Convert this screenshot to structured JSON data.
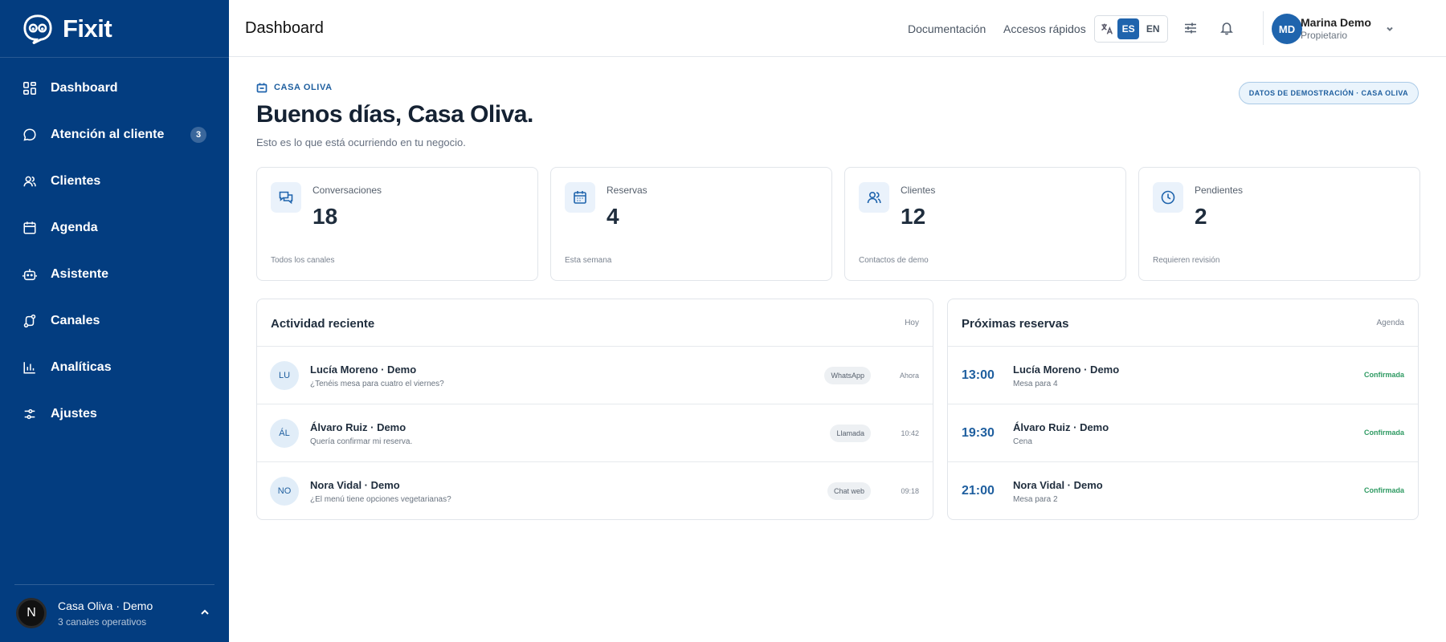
{
  "app": {
    "name": "Fixit"
  },
  "sidebar": {
    "items": [
      {
        "label": "Dashboard",
        "icon": "grid-icon"
      },
      {
        "label": "Atención al cliente",
        "icon": "chat-bubble-icon",
        "badge": "3"
      },
      {
        "label": "Clientes",
        "icon": "users-icon"
      },
      {
        "label": "Agenda",
        "icon": "calendar-icon"
      },
      {
        "label": "Asistente",
        "icon": "bot-icon"
      },
      {
        "label": "Canales",
        "icon": "route-icon"
      },
      {
        "label": "Analíticas",
        "icon": "bar-chart-icon"
      },
      {
        "label": "Ajustes",
        "icon": "sliders-icon"
      }
    ],
    "workspace": {
      "avatar": "N",
      "name": "Casa Oliva · Demo",
      "sub": "3 canales operativos"
    }
  },
  "header": {
    "title": "Dashboard",
    "links": [
      "Documentación",
      "Accesos rápidos"
    ],
    "lang": {
      "active": "ES",
      "other": "EN"
    },
    "user": {
      "initials": "MD",
      "name": "Marina Demo",
      "role": "Propietario"
    }
  },
  "main": {
    "business": "CASA OLIVA",
    "demo_badge": "DATOS DE DEMOSTRACIÓN · CASA OLIVA",
    "greeting": "Buenos días, Casa Oliva.",
    "subtitle": "Esto es lo que está ocurriendo en tu negocio.",
    "stats": [
      {
        "label": "Conversaciones",
        "value": "18",
        "foot": "Todos los canales",
        "icon": "chat-icon"
      },
      {
        "label": "Reservas",
        "value": "4",
        "foot": "Esta semana",
        "icon": "calendar-icon"
      },
      {
        "label": "Clientes",
        "value": "12",
        "foot": "Contactos de demo",
        "icon": "users-icon"
      },
      {
        "label": "Pendientes",
        "value": "2",
        "foot": "Requieren revisión",
        "icon": "clock-icon"
      }
    ],
    "activity": {
      "title": "Actividad reciente",
      "meta": "Hoy",
      "rows": [
        {
          "initials": "LU",
          "name": "Lucía Moreno · Demo",
          "msg": "¿Tenéis mesa para cuatro el viernes?",
          "channel": "WhatsApp",
          "time": "Ahora"
        },
        {
          "initials": "ÁL",
          "name": "Álvaro Ruiz · Demo",
          "msg": "Quería confirmar mi reserva.",
          "channel": "Llamada",
          "time": "10:42"
        },
        {
          "initials": "NO",
          "name": "Nora Vidal · Demo",
          "msg": "¿El menú tiene opciones vegetarianas?",
          "channel": "Chat web",
          "time": "09:18"
        }
      ]
    },
    "bookings": {
      "title": "Próximas reservas",
      "meta": "Agenda",
      "rows": [
        {
          "time": "13:00",
          "name": "Lucía Moreno · Demo",
          "detail": "Mesa para 4",
          "status": "Confirmada"
        },
        {
          "time": "19:30",
          "name": "Álvaro Ruiz · Demo",
          "detail": "Cena",
          "status": "Confirmada"
        },
        {
          "time": "21:00",
          "name": "Nora Vidal · Demo",
          "detail": "Mesa para 2",
          "status": "Confirmada"
        }
      ]
    }
  }
}
